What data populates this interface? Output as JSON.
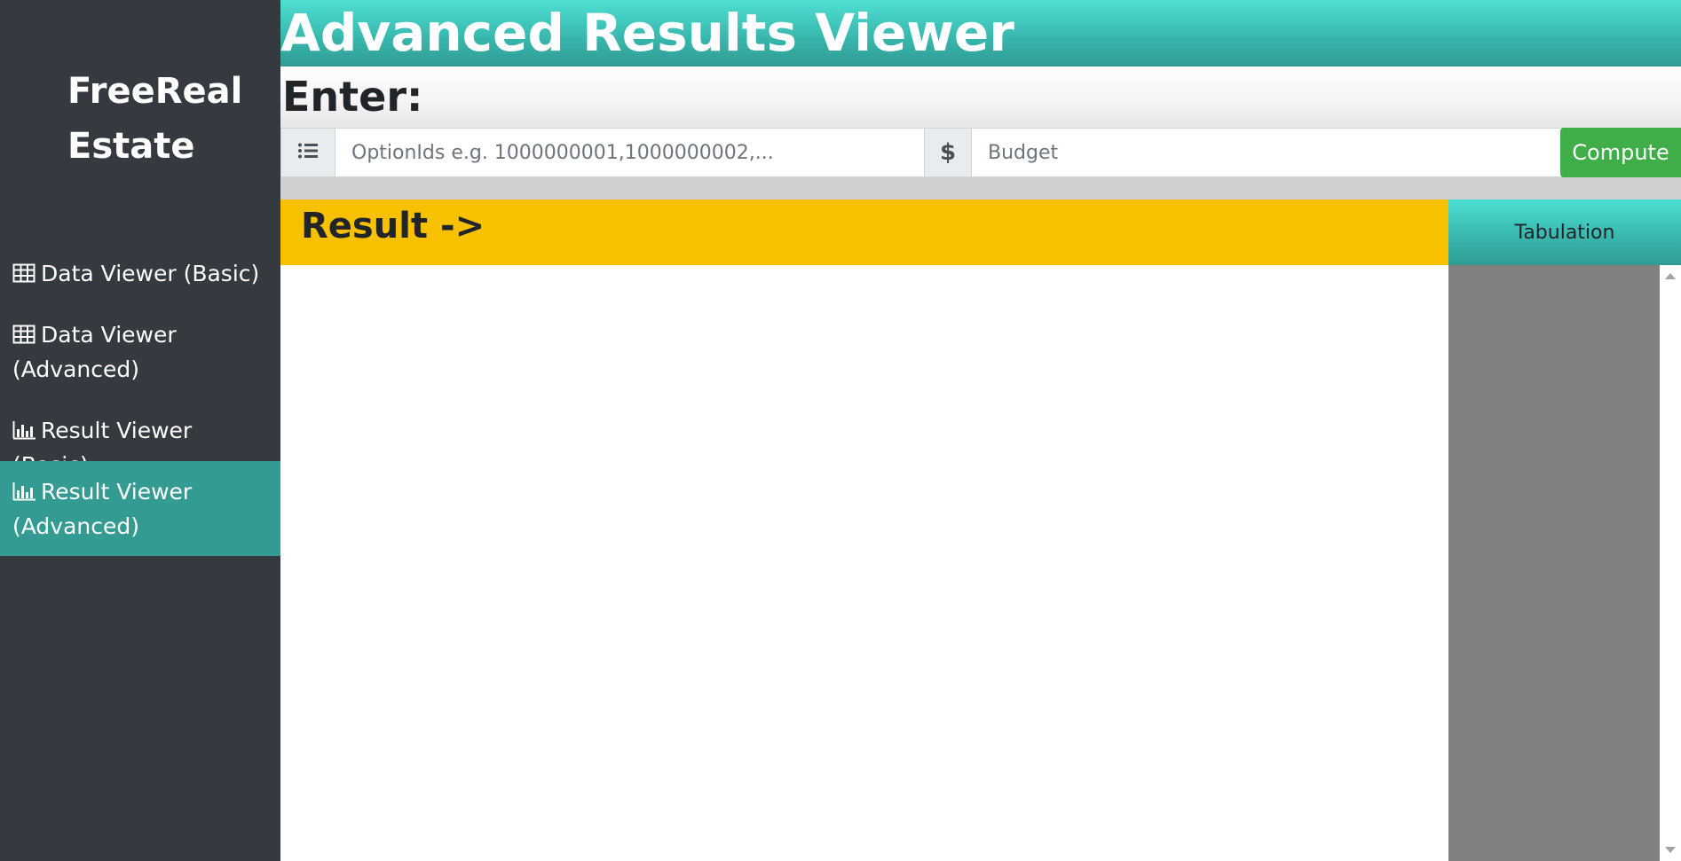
{
  "brand": {
    "line1": "FreeReal",
    "line2": "Estate"
  },
  "sidebar": {
    "items": [
      {
        "label": "Data Viewer (Basic)",
        "icon": "table-icon",
        "active": false
      },
      {
        "label": "Data Viewer (Advanced)",
        "icon": "table-icon",
        "active": false
      },
      {
        "label": "Result Viewer (Basic)",
        "icon": "bar-chart-icon",
        "active": false
      },
      {
        "label": "Result Viewer (Advanced)",
        "icon": "bar-chart-icon",
        "active": true
      }
    ]
  },
  "header": {
    "title": "Advanced Results Viewer"
  },
  "enter": {
    "label": "Enter:",
    "options_icon": "list-icon",
    "options_placeholder": "OptionIds e.g. 1000000001,1000000002,...",
    "options_value": "",
    "budget_symbol": "$",
    "budget_placeholder": "Budget",
    "budget_value": "",
    "compute_label": "Compute"
  },
  "result": {
    "label": "Result ->"
  },
  "tabulation": {
    "label": "Tabulation"
  },
  "colors": {
    "sidebar_bg": "#343a40",
    "active_item_bg": "#339b92",
    "header_teal": "#38b5ab",
    "result_yellow": "#f8c100",
    "compute_green": "#3fae49",
    "tab_body_gray": "#808080"
  }
}
